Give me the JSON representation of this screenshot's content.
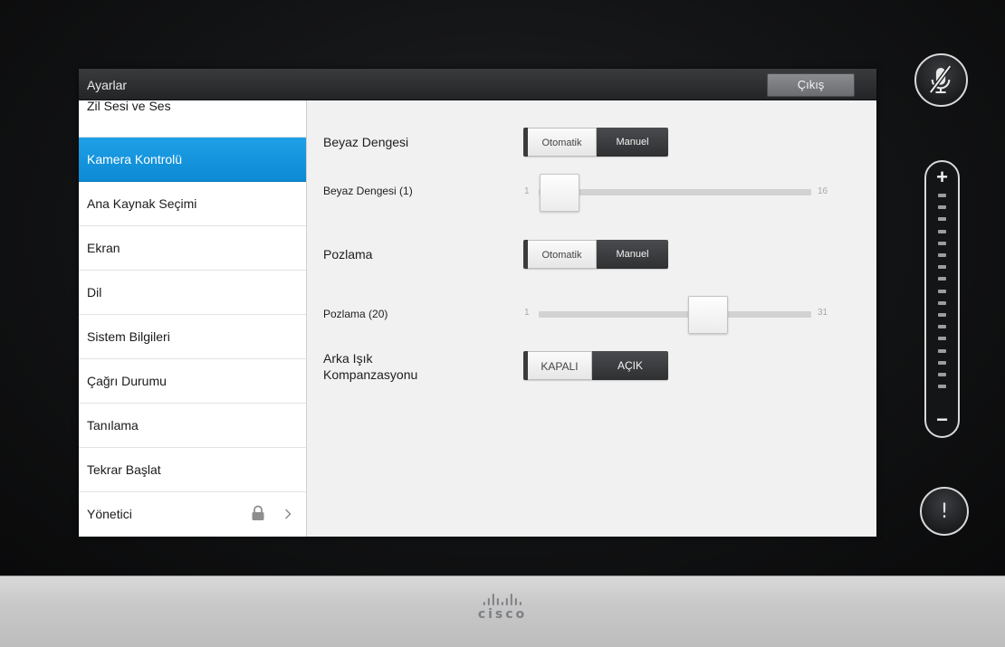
{
  "window": {
    "title": "Ayarlar",
    "exit_label": "Çıkış"
  },
  "sidebar": {
    "items": [
      {
        "label": "Zil Sesi ve Ses"
      },
      {
        "label": "Kamera Kontrolü"
      },
      {
        "label": "Ana Kaynak Seçimi"
      },
      {
        "label": "Ekran"
      },
      {
        "label": "Dil"
      },
      {
        "label": "Sistem Bilgileri"
      },
      {
        "label": "Çağrı Durumu"
      },
      {
        "label": "Tanılama"
      },
      {
        "label": "Tekrar Başlat"
      },
      {
        "label": "Yönetici"
      }
    ],
    "selected_index": 1
  },
  "camera": {
    "white_balance": {
      "label": "Beyaz Dengesi",
      "opt_a": "Otomatik",
      "opt_b": "Manuel",
      "active": "Manuel"
    },
    "white_balance_slider": {
      "label": "Beyaz Dengesi (1)",
      "min": "1",
      "max": "16",
      "value": 1
    },
    "exposure": {
      "label": "Pozlama",
      "opt_a": "Otomatik",
      "opt_b": "Manuel",
      "active": "Manuel"
    },
    "exposure_slider": {
      "label": "Pozlama (20)",
      "min": "1",
      "max": "31",
      "value": 20
    },
    "backlight": {
      "label_line1": "Arka Işık",
      "label_line2": "Kompanzasyonu",
      "opt_a": "KAPALI",
      "opt_b": "AÇIK",
      "active": "AÇIK"
    }
  },
  "side_controls": {
    "mute_icon": "microphone-muted-icon",
    "volume_plus": "+",
    "volume_minus": "−",
    "alert_icon": "exclamation-icon",
    "alert_text": "!"
  },
  "brand": {
    "logo_text": "cisco"
  },
  "colors": {
    "accent": "#1193DB",
    "titlebar": "#2B2C2E",
    "panel": "#F1F1F1"
  }
}
